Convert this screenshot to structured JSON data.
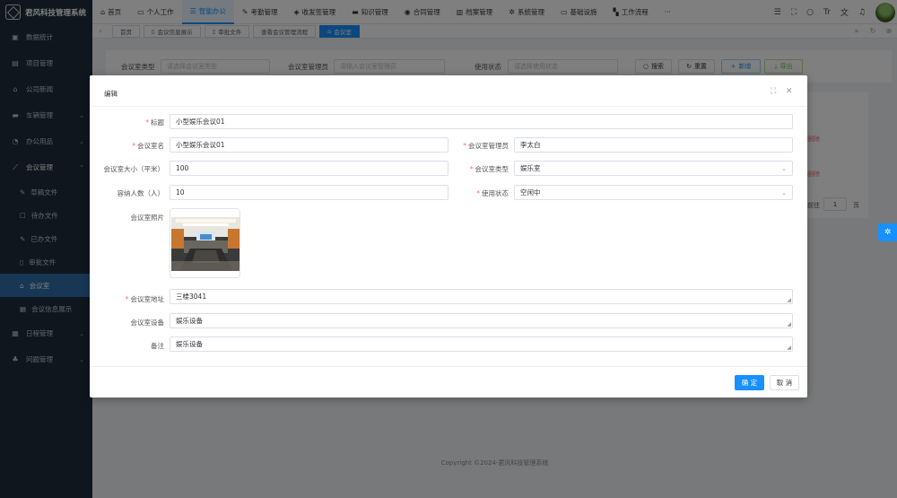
{
  "app": {
    "title": "君风科技管理系统"
  },
  "sidebar": {
    "items": [
      {
        "label": "数据统计",
        "icon": "chart-icon"
      },
      {
        "label": "项目管理",
        "icon": "project-icon"
      },
      {
        "label": "公司新闻",
        "icon": "bank-icon"
      },
      {
        "label": "车辆管理",
        "icon": "car-icon"
      },
      {
        "label": "办公用品",
        "icon": "pie-icon"
      },
      {
        "label": "会议管理",
        "icon": "wand-icon"
      },
      {
        "label": "日程管理",
        "icon": "calendar-icon"
      },
      {
        "label": "问题管理",
        "icon": "bell-icon"
      }
    ],
    "subitems": [
      {
        "label": "草稿文件"
      },
      {
        "label": "待办文件"
      },
      {
        "label": "已办文件"
      },
      {
        "label": "审批文件"
      },
      {
        "label": "会议室"
      },
      {
        "label": "会议信息展示"
      }
    ]
  },
  "topnav": {
    "items": [
      {
        "label": "首页"
      },
      {
        "label": "个人工作"
      },
      {
        "label": "智能办公"
      },
      {
        "label": "考勤管理"
      },
      {
        "label": "收发签管理"
      },
      {
        "label": "知识管理"
      },
      {
        "label": "合同管理"
      },
      {
        "label": "档案管理"
      },
      {
        "label": "系统管理"
      },
      {
        "label": "基础设施"
      },
      {
        "label": "工作流程"
      },
      {
        "label": "···"
      }
    ]
  },
  "tabs": [
    "首页",
    "会议信息展示",
    "审批文件",
    "查看会议管理流程",
    "会议室"
  ],
  "search": {
    "type_label": "会议室类型",
    "type_placeholder": "请选择会议室类型",
    "admin_label": "会议室管理员",
    "admin_placeholder": "请输入会议室管理员",
    "status_label": "使用状态",
    "status_placeholder": "请选择使用状态",
    "search_btn": "搜索",
    "reset_btn": "重置",
    "add_btn": "新增",
    "export_btn": "导出"
  },
  "background": {
    "delete_1": "删除",
    "delete_2": "删除",
    "goto_label": "前往",
    "page_num": "1",
    "page_unit": "页",
    "copyright": "Copyright ©2024-君风科技管理系统"
  },
  "dialog": {
    "title": "编辑",
    "fields": {
      "title_label": "标题",
      "title_value": "小型娱乐会议01",
      "name_label": "会议室名",
      "name_value": "小型娱乐会议01",
      "admin_label": "会议室管理员",
      "admin_value": "李太白",
      "size_label": "会议室大小（平米）",
      "size_value": "100",
      "type_label": "会议室类型",
      "type_value": "娱乐室",
      "capacity_label": "容纳人数（人）",
      "capacity_value": "10",
      "status_label": "使用状态",
      "status_value": "空闲中",
      "photo_label": "会议室照片",
      "address_label": "会议室地址",
      "address_value": "三楼3041",
      "equipment_label": "会议室设备",
      "equipment_value": "娱乐设备",
      "remark_label": "备注",
      "remark_value": "娱乐设备"
    },
    "ok": "确 定",
    "cancel": "取 消"
  }
}
